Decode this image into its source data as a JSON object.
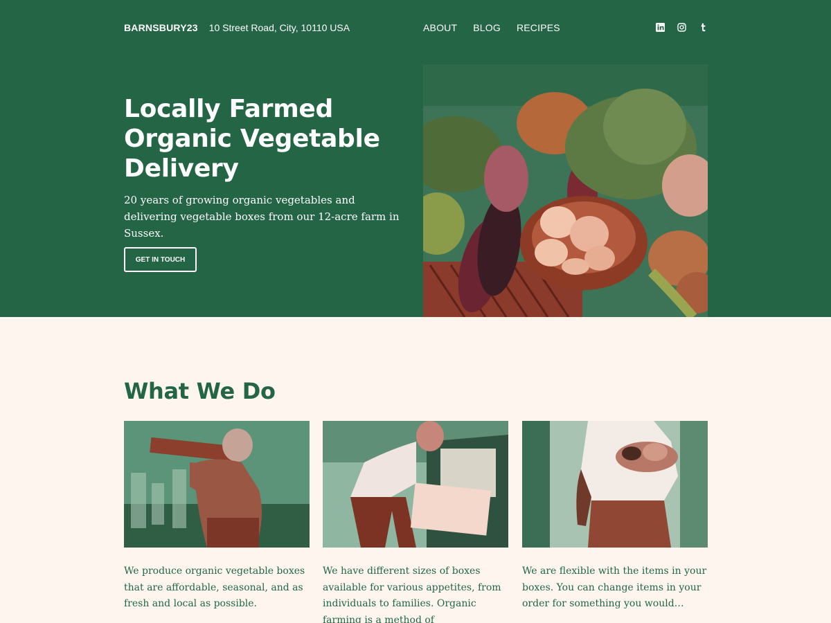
{
  "header": {
    "brand": "BARNSBURY23",
    "address": "10 Street Road, City, 10110 USA",
    "menu": [
      {
        "label": "ABOUT"
      },
      {
        "label": "BLOG"
      },
      {
        "label": "RECIPES"
      }
    ],
    "social": [
      {
        "icon": "linkedin-icon"
      },
      {
        "icon": "instagram-icon"
      },
      {
        "icon": "tumblr-icon"
      }
    ]
  },
  "hero": {
    "title": "Locally Farmed Organic Vegetable Delivery",
    "subtitle": "20 years of growing organic vegetables and delivering vegetable boxes from our 12-acre farm in Sussex.",
    "cta_label": "GET IN TOUCH"
  },
  "what_we_do": {
    "title": "What We Do",
    "cards": [
      {
        "text": "We produce organic vegetable boxes that are affordable, seasonal, and as fresh and local as possible."
      },
      {
        "text": "We have different sizes of boxes available for various appetites, from individuals to families. Organic farming is a method of"
      },
      {
        "text": "We are flexible with the items in your boxes. You can change items in your order for something you would…"
      }
    ]
  },
  "colors": {
    "primary_green": "#236545",
    "cream_background": "#fdf5ee",
    "text_white": "#ffffff"
  }
}
